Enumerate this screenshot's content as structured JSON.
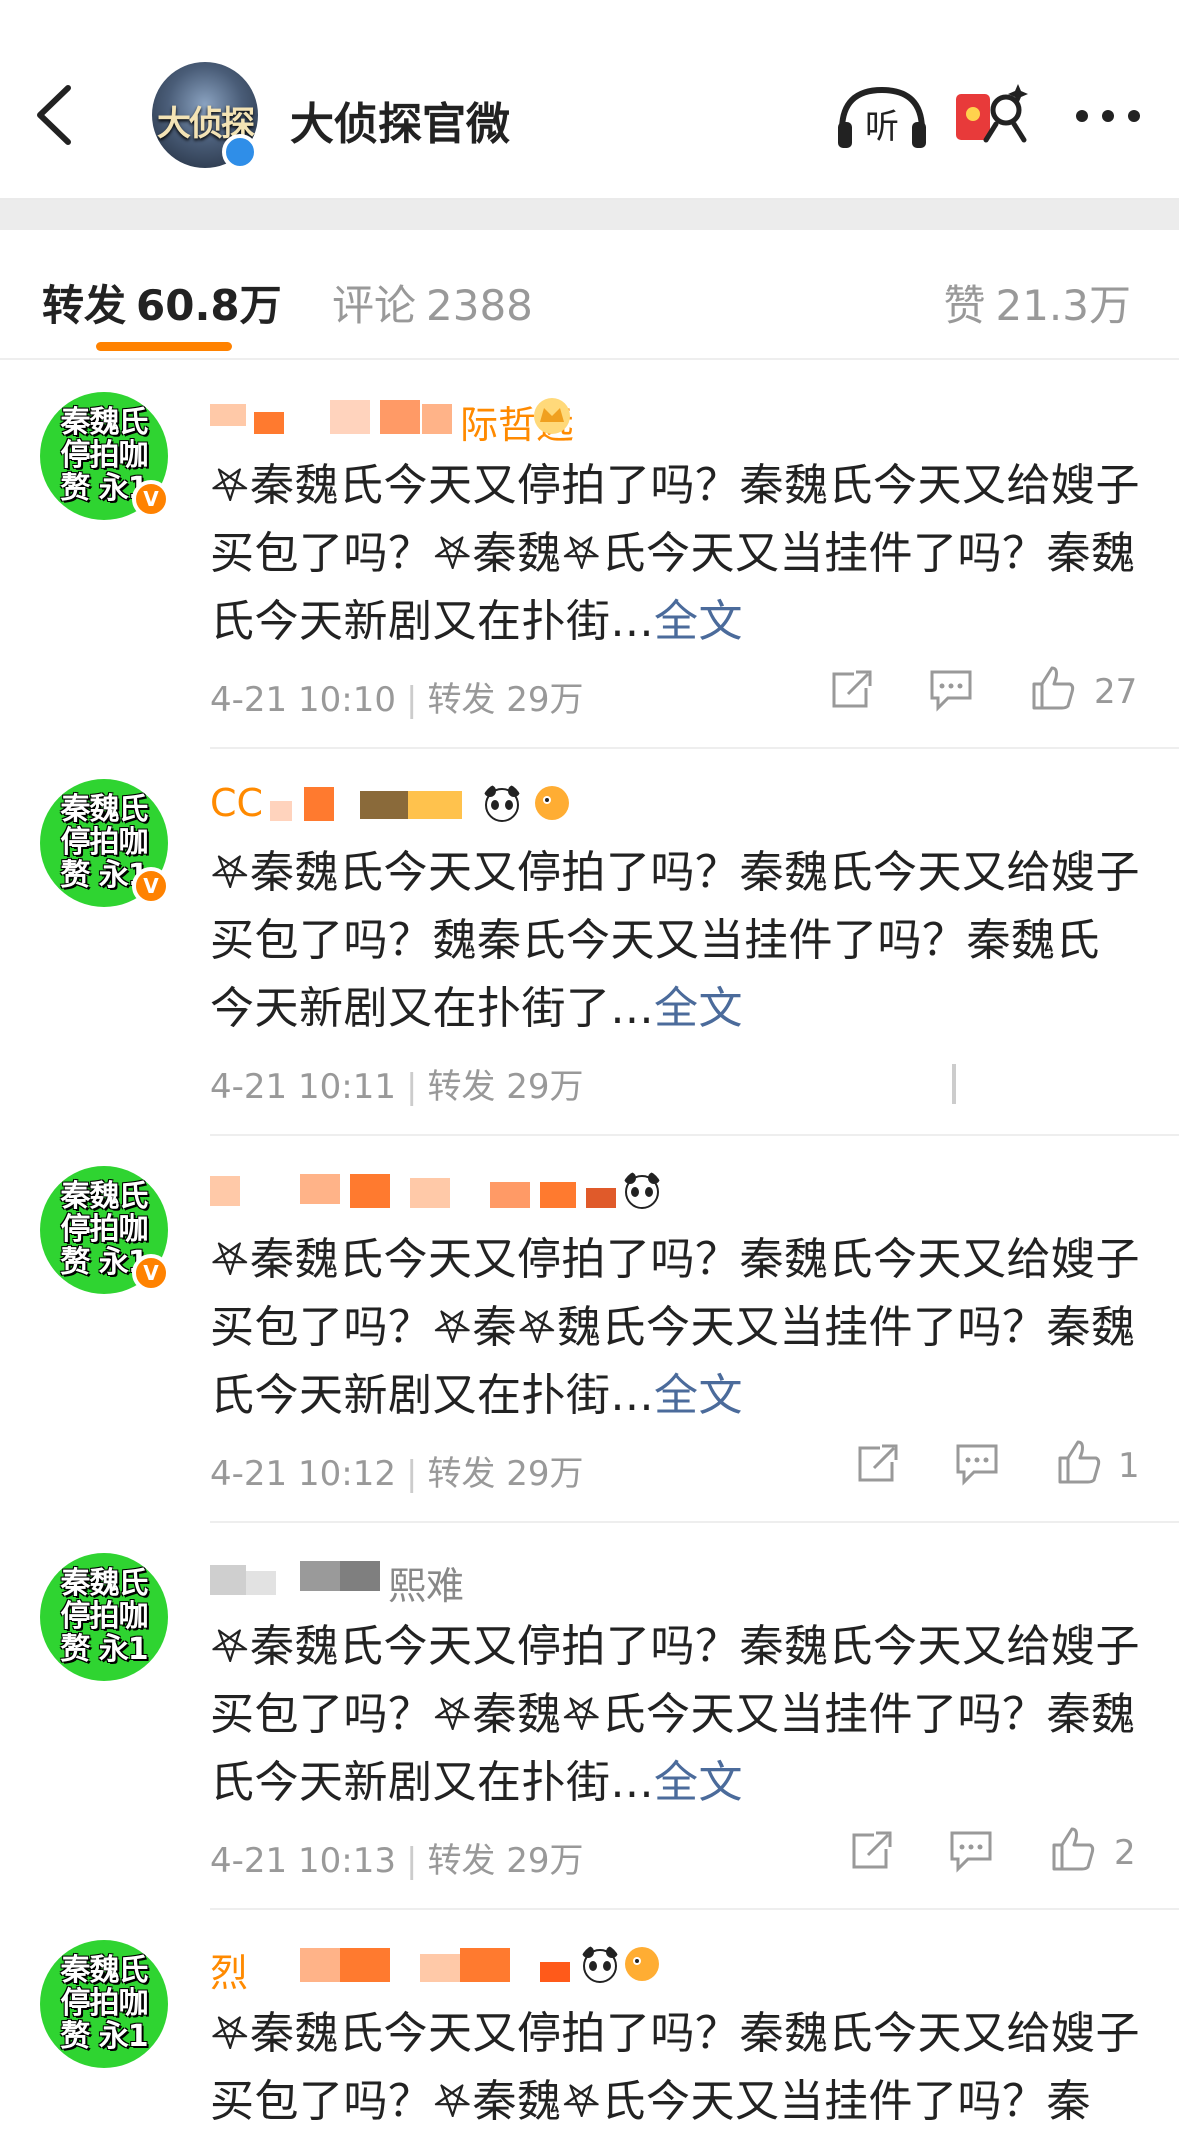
{
  "header": {
    "title": "大侦探官微",
    "avatar_logo_text": "大侦探",
    "icons": {
      "back": "back-arrow-icon",
      "listen": "headphones-listen-icon",
      "listen_label": "听",
      "red_packet": "red-packet-icon",
      "more": "more-dots-icon"
    }
  },
  "tabs": {
    "repost": {
      "label": "转发",
      "count": "60.8万"
    },
    "comment": {
      "label": "评论",
      "count": "2388"
    },
    "like": {
      "label": "赞",
      "count": "21.3万"
    }
  },
  "colors": {
    "accent": "#ff8200",
    "link": "#4b6b9b",
    "avatar_green": "#2fd431"
  },
  "posts": [
    {
      "avatar_text": [
        "秦魏氏",
        "停拍咖",
        "赘 永1"
      ],
      "username_tail": "际哲远",
      "text_main": "𖤐秦魏氏今天又停拍了吗？秦魏氏今天又给嫂子买包了吗？𖤐秦魏𖤐氏今天又当挂件了吗？秦魏氏今天新剧又在扑街...",
      "full_label": "全文",
      "date": "4-21 10:10",
      "repost_label": "转发",
      "repost_count": "29万",
      "like_count": "27"
    },
    {
      "avatar_text": [
        "秦魏氏",
        "停拍咖",
        "赘 永1"
      ],
      "username_tail": "CC",
      "text_main": "𖤐秦魏氏今天又停拍了吗？秦魏氏今天又给嫂子买包了吗？魏秦氏今天又当挂件了吗？秦魏氏今天新剧又在扑街了...",
      "full_label": "全文",
      "date": "4-21 10:11",
      "repost_label": "转发",
      "repost_count": "29万",
      "like_count": ""
    },
    {
      "avatar_text": [
        "秦魏氏",
        "停拍咖",
        "赘 永1"
      ],
      "username_tail": "",
      "text_main": "𖤐秦魏氏今天又停拍了吗？秦魏氏今天又给嫂子买包了吗？𖤐秦𖤐魏氏今天又当挂件了吗？秦魏氏今天新剧又在扑街...",
      "full_label": "全文",
      "date": "4-21 10:12",
      "repost_label": "转发",
      "repost_count": "29万",
      "like_count": "1"
    },
    {
      "avatar_text": [
        "秦魏氏",
        "停拍咖",
        "赘 永1"
      ],
      "username_tail": "熙难",
      "text_main": "𖤐秦魏氏今天又停拍了吗？秦魏氏今天又给嫂子买包了吗？𖤐秦魏𖤐氏今天又当挂件了吗？秦魏氏今天新剧又在扑街...",
      "full_label": "全文",
      "date": "4-21 10:13",
      "repost_label": "转发",
      "repost_count": "29万",
      "like_count": "2"
    },
    {
      "avatar_text": [
        "秦魏氏",
        "停拍咖",
        "赘 永1"
      ],
      "username_tail": "烈",
      "text_main": "𖤐秦魏氏今天又停拍了吗？秦魏氏今天又给嫂子买包了吗？𖤐秦魏𖤐氏今天又当挂件了吗？秦",
      "full_label": "",
      "date": "",
      "repost_label": "",
      "repost_count": "",
      "like_count": ""
    }
  ]
}
